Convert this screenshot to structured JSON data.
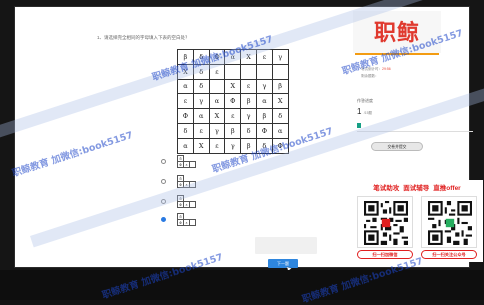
{
  "question": {
    "number_title": "1、请选择完全相同的字母填入下表的空白处？",
    "grid": [
      [
        "β",
        "δ",
        "Φ",
        "α",
        "Χ",
        "ε",
        "γ"
      ],
      [
        "Χ",
        "δ",
        "ε",
        "",
        "",
        "",
        ""
      ],
      [
        "α",
        "δ",
        "",
        "Χ",
        "ε",
        "γ",
        "β"
      ],
      [
        "ε",
        "γ",
        "α",
        "Φ",
        "β",
        "α",
        "Χ"
      ],
      [
        "Φ",
        "α",
        "Χ",
        "ε",
        "γ",
        "β",
        "δ"
      ],
      [
        "δ",
        "ε",
        "γ",
        "β",
        "δ",
        "Φ",
        "α"
      ],
      [
        "α",
        "Χ",
        "ε",
        "γ",
        "β",
        "δ",
        "Φ"
      ]
    ],
    "options": [
      {
        "cells": [
          [
            "δ",
            "",
            ""
          ],
          [
            "Φ",
            "ε",
            ""
          ]
        ]
      },
      {
        "cells": [
          [
            "δ",
            "",
            ""
          ],
          [
            "Φ",
            "ε",
            ""
          ]
        ]
      },
      {
        "cells": [
          [
            "δ",
            "",
            ""
          ],
          [
            "Φ",
            "ε",
            ""
          ]
        ]
      },
      {
        "cells": [
          [
            "δ",
            "",
            ""
          ],
          [
            "Φ",
            "ε",
            ""
          ]
        ]
      }
    ]
  },
  "next_button": "下一题",
  "sidebar": {
    "logo_text": "职鲸",
    "info_line1": "笔试倒计时：",
    "info_time": "29:56",
    "info_line2": "剩余题数：",
    "progress_label": "作答进度",
    "progress_current": "1",
    "progress_total": "/15题",
    "progress_fraction": 0.067,
    "submit_button": "交卷并提交",
    "ad": {
      "title_parts": [
        "笔试助攻",
        "面试辅导",
        "直推offer"
      ],
      "qr_labels": [
        "扫一扫加微信",
        "扫一扫关注公众号"
      ]
    }
  },
  "watermark": "职鲸教育 加微信:book5157",
  "colors": {
    "accent": "#2e86de",
    "brand": "#e03a2f",
    "orange": "#f39c12",
    "teal": "#16a085"
  }
}
